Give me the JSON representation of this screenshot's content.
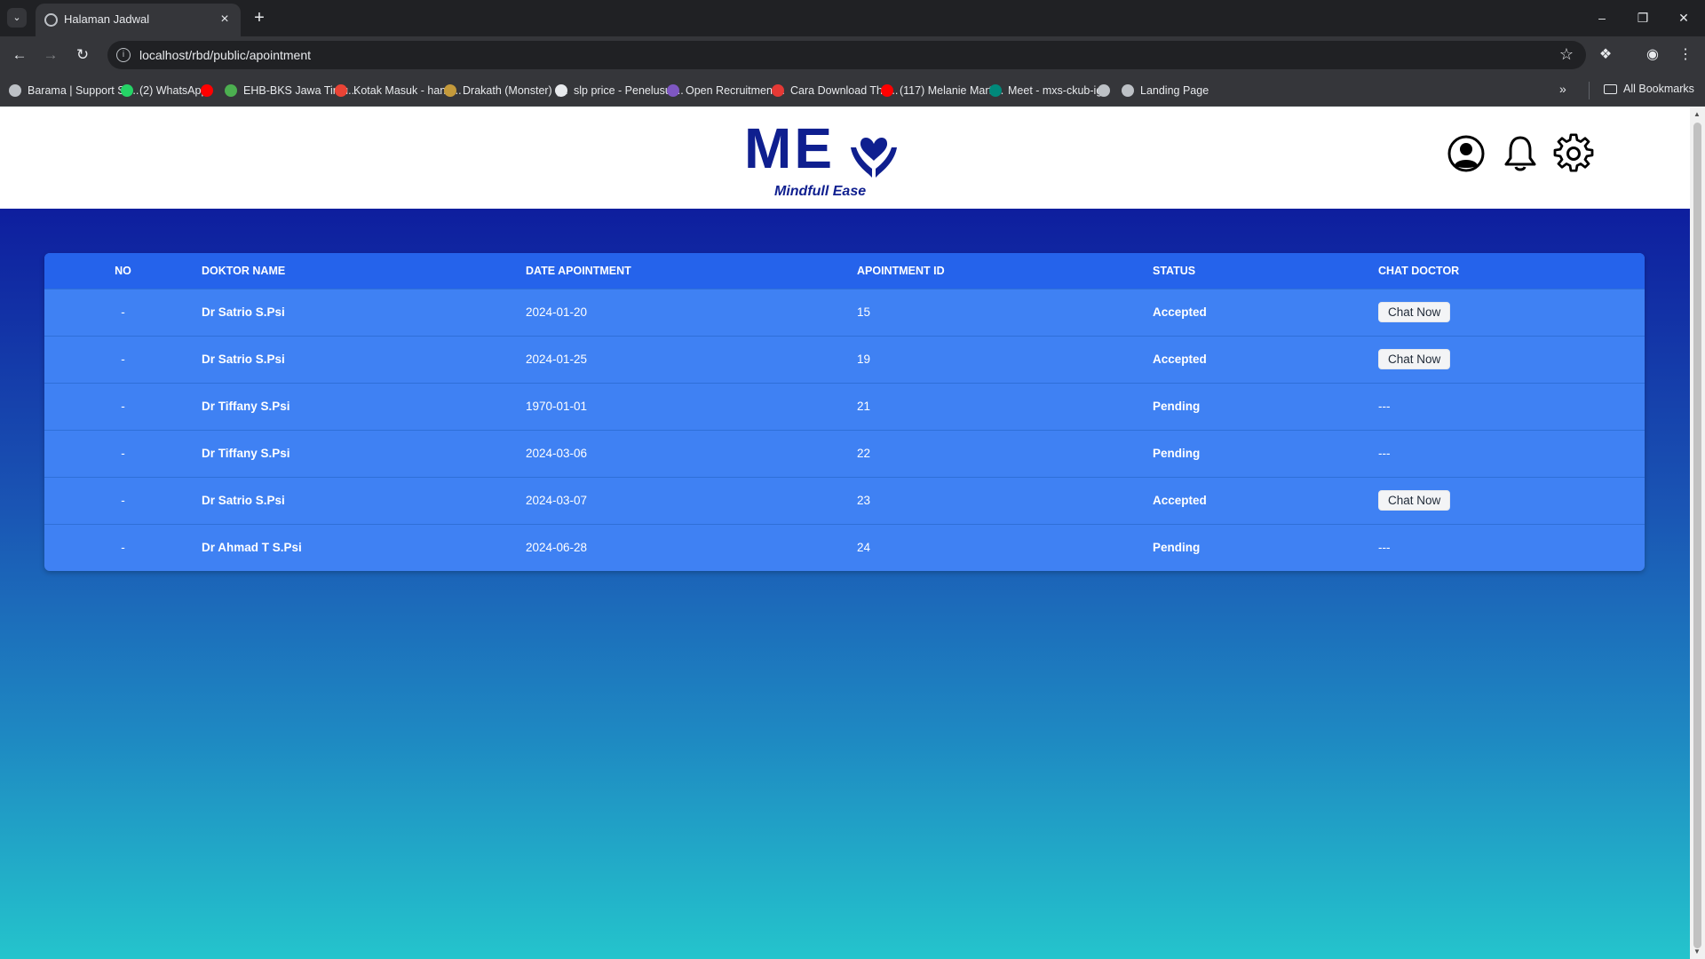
{
  "browser": {
    "tab_title": "Halaman Jadwal",
    "url": "localhost/rbd/public/apointment",
    "bookmarks": [
      {
        "label": "Barama | Support Sy...",
        "color": "#bdc1c6"
      },
      {
        "label": "(2) WhatsApp",
        "color": "#25d366"
      },
      {
        "label": "",
        "color": "#ff0000"
      },
      {
        "label": "EHB-BKS Jawa Timu...",
        "color": "#4caf50"
      },
      {
        "label": "Kotak Masuk - hand...",
        "color": "#ea4335"
      },
      {
        "label": "Drakath (Monster) (...",
        "color": "#c49a3b"
      },
      {
        "label": "slp price - Penelusur...",
        "color": "#e8eaed"
      },
      {
        "label": "Open Recruitment...",
        "color": "#7e57c2"
      },
      {
        "label": "Cara Download The...",
        "color": "#e53935"
      },
      {
        "label": "(117) Melanie Marti...",
        "color": "#ff0000"
      },
      {
        "label": "Meet - mxs-ckub-ige",
        "color": "#00897b"
      },
      {
        "label": "",
        "color": "#bdc1c6"
      },
      {
        "label": "Landing Page",
        "color": "#bdc1c6"
      }
    ],
    "all_bookmarks": "All Bookmarks"
  },
  "header": {
    "logo_text": "ME",
    "logo_tagline": "Mindfull Ease",
    "brand_color": "#0f1f8f"
  },
  "table": {
    "columns": [
      "NO",
      "DOKTOR NAME",
      "DATE APOINTMENT",
      "APOINTMENT ID",
      "STATUS",
      "CHAT DOCTOR"
    ],
    "rows": [
      {
        "no": "-",
        "doctor": "Dr Satrio S.Psi",
        "date": "2024-01-20",
        "id": "15",
        "status": "Accepted",
        "chat": "Chat Now"
      },
      {
        "no": "-",
        "doctor": "Dr Satrio S.Psi",
        "date": "2024-01-25",
        "id": "19",
        "status": "Accepted",
        "chat": "Chat Now"
      },
      {
        "no": "-",
        "doctor": "Dr Tiffany S.Psi",
        "date": "1970-01-01",
        "id": "21",
        "status": "Pending",
        "chat": "---"
      },
      {
        "no": "-",
        "doctor": "Dr Tiffany S.Psi",
        "date": "2024-03-06",
        "id": "22",
        "status": "Pending",
        "chat": "---"
      },
      {
        "no": "-",
        "doctor": "Dr Satrio S.Psi",
        "date": "2024-03-07",
        "id": "23",
        "status": "Accepted",
        "chat": "Chat Now"
      },
      {
        "no": "-",
        "doctor": "Dr Ahmad T S.Psi",
        "date": "2024-06-28",
        "id": "24",
        "status": "Pending",
        "chat": "---"
      }
    ]
  },
  "colors": {
    "table_header": "#2563eb",
    "table_body": "#3f81f3",
    "gradient_top": "#0e1e9e",
    "gradient_bottom": "#24c4cc"
  }
}
